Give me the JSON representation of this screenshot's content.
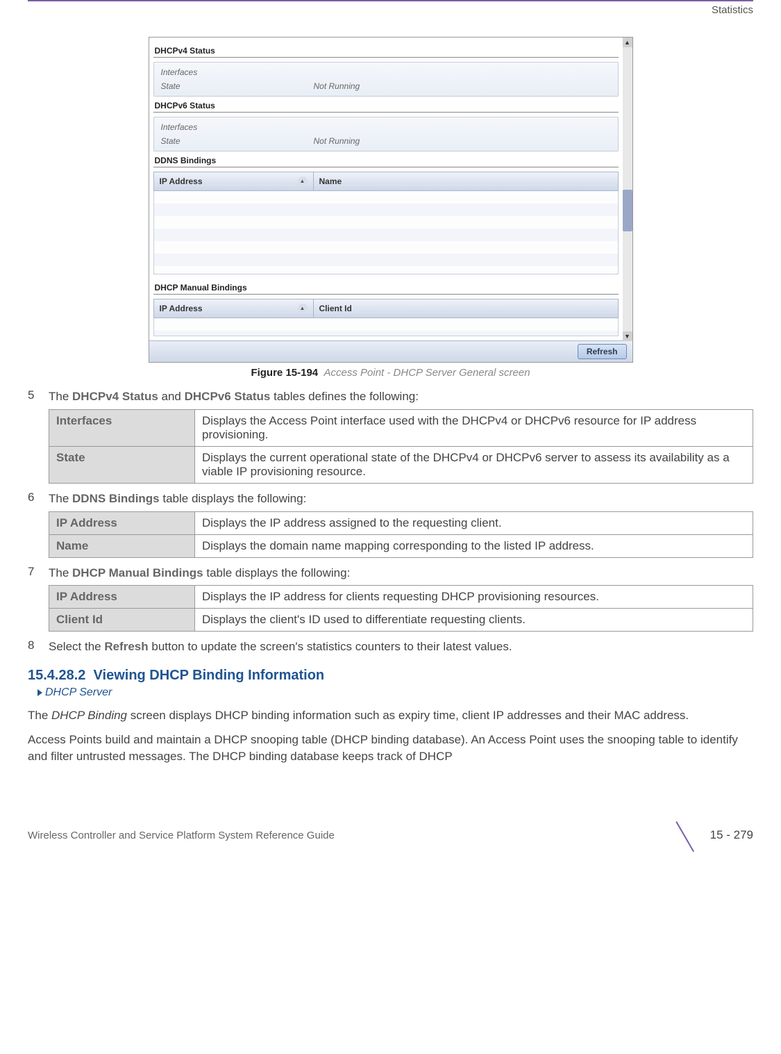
{
  "header": {
    "section": "Statistics"
  },
  "screenshot": {
    "dhcpv4": {
      "title": "DHCPv4 Status",
      "interfaces_label": "Interfaces",
      "state_label": "State",
      "state_value": "Not Running"
    },
    "dhcpv6": {
      "title": "DHCPv6 Status",
      "interfaces_label": "Interfaces",
      "state_label": "State",
      "state_value": "Not Running"
    },
    "ddns": {
      "title": "DDNS Bindings",
      "col_ip": "IP Address",
      "col_name": "Name"
    },
    "manual": {
      "title": "DHCP Manual Bindings",
      "col_ip": "IP Address",
      "col_client": "Client Id"
    },
    "refresh": "Refresh"
  },
  "caption": {
    "label": "Figure 15-194",
    "text": "Access Point - DHCP Server General screen"
  },
  "items": {
    "n5": "5",
    "t5a": "The ",
    "t5b": "DHCPv4 Status",
    "t5c": " and ",
    "t5d": "DHCPv6 Status",
    "t5e": " tables defines the following:",
    "n6": "6",
    "t6a": "The ",
    "t6b": "DDNS Bindings",
    "t6c": " table displays the following:",
    "n7": "7",
    "t7a": "The ",
    "t7b": "DHCP Manual Bindings",
    "t7c": " table displays the following:",
    "n8": "8",
    "t8a": "Select the ",
    "t8b": "Refresh",
    "t8c": " button to update the screen's statistics counters to their latest values."
  },
  "table1": {
    "k1": "Interfaces",
    "v1": "Displays the Access Point interface used with the DHCPv4 or DHCPv6 resource for IP address provisioning.",
    "k2": "State",
    "v2": "Displays the current operational state of the DHCPv4 or DHCPv6 server to assess its availability as a viable IP provisioning resource."
  },
  "table2": {
    "k1": "IP Address",
    "v1": "Displays the IP address assigned to the requesting client.",
    "k2": "Name",
    "v2": "Displays the domain name mapping corresponding to the listed IP address."
  },
  "table3": {
    "k1": "IP Address",
    "v1": "Displays the IP address for clients requesting DHCP provisioning resources.",
    "k2": "Client Id",
    "v2": "Displays the client's ID used to differentiate requesting clients."
  },
  "section": {
    "number": "15.4.28.2",
    "title": "Viewing DHCP Binding Information",
    "breadcrumb": "DHCP Server"
  },
  "paras": {
    "p1a": "The ",
    "p1b": "DHCP Binding",
    "p1c": " screen displays DHCP binding information such as expiry time, client IP addresses and their MAC address.",
    "p2": "Access Points build and maintain a DHCP snooping table (DHCP binding database). An Access Point uses the snooping table to identify and filter untrusted messages. The DHCP binding database keeps track of DHCP"
  },
  "footer": {
    "guide": "Wireless Controller and Service Platform System Reference Guide",
    "page": "15 - 279"
  }
}
